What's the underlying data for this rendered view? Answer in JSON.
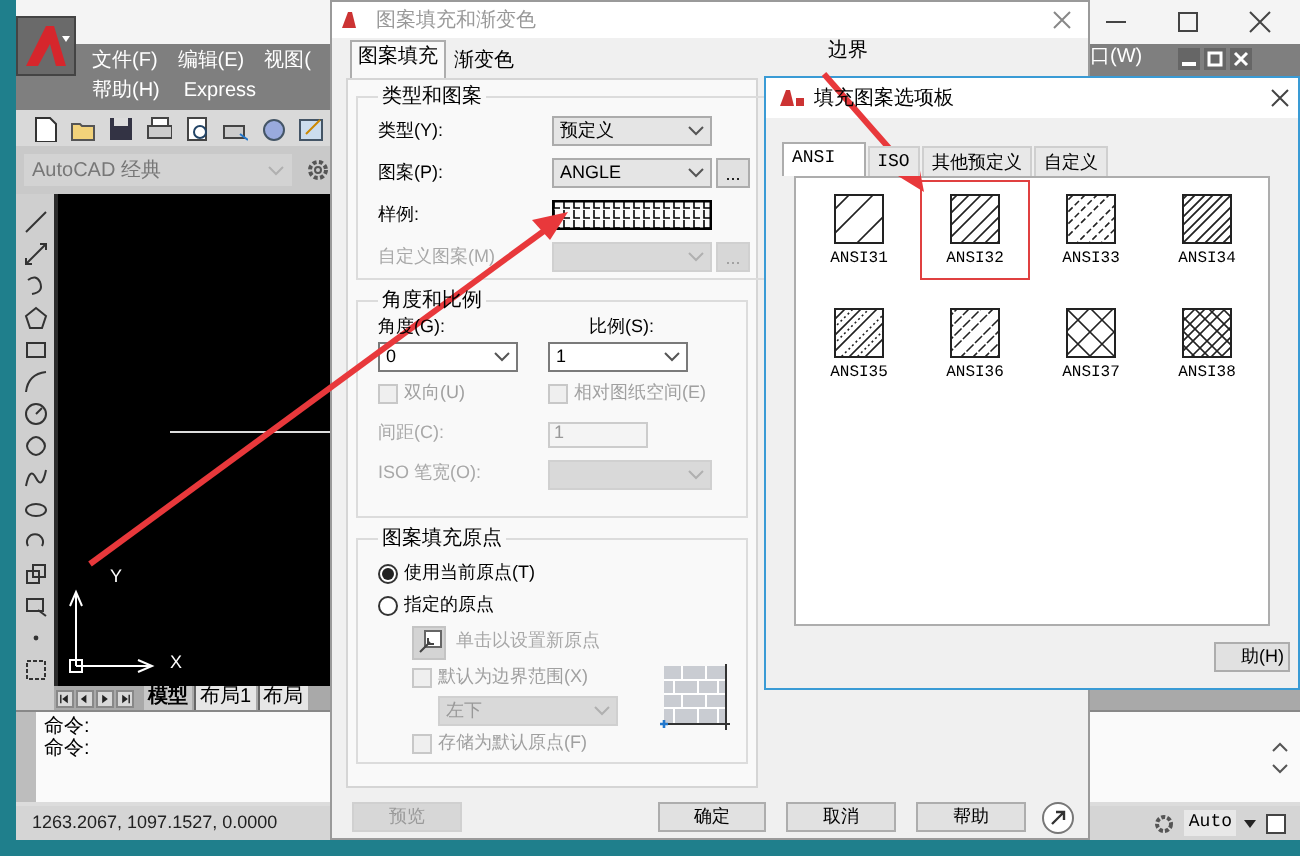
{
  "main_window": {
    "menu_row_1": [
      "文件(F)",
      "编辑(E)",
      "视图("
    ],
    "menu_row_2": [
      "帮助(H)",
      "Express"
    ],
    "menu_right": "口(W)",
    "workspace": "AutoCAD 经典",
    "axis_y": "Y",
    "axis_x": "X",
    "layout_tabs": [
      {
        "label": "模型",
        "selected": true
      },
      {
        "label": "布局1",
        "selected": false
      },
      {
        "label": "布局",
        "selected": false
      }
    ],
    "command_lines": [
      "命令:",
      "命令:"
    ],
    "coordinates": "1263.2067, 1097.1527, 0.0000",
    "status_mode": "Auto"
  },
  "hatch_dialog": {
    "title": "图案填充和渐变色",
    "tabs": [
      {
        "label": "图案填充",
        "selected": true
      },
      {
        "label": "渐变色",
        "selected": false
      }
    ],
    "boundary_heading": "边界",
    "type_group": {
      "heading": "类型和图案",
      "rows": [
        {
          "kind": "dropdown",
          "label": "类型(Y):",
          "value": "预定义",
          "disabled": false
        },
        {
          "kind": "dropdown_more",
          "label": "图案(P):",
          "value": "ANGLE",
          "more": "...",
          "disabled": false
        },
        {
          "kind": "swatch",
          "label": "样例:",
          "disabled": false
        },
        {
          "kind": "dropdown_more",
          "label": "自定义图案(M)",
          "more": "...",
          "disabled": true
        }
      ]
    },
    "angle_group": {
      "heading": "角度和比例",
      "angle": {
        "label": "角度(G):",
        "value": "0"
      },
      "scale": {
        "label": "比例(S):",
        "value": "1"
      },
      "checkboxes": [
        {
          "label": "双向(U)",
          "checked": false,
          "disabled": true
        },
        {
          "label": "相对图纸空间(E)",
          "checked": false,
          "disabled": true
        }
      ],
      "spacing": {
        "label": "间距(C):",
        "value": "1",
        "disabled": true
      },
      "iso_pen": {
        "label": "ISO 笔宽(O):",
        "disabled": true
      }
    },
    "origin_group": {
      "heading": "图案填充原点",
      "radios": [
        {
          "label": "使用当前原点(T)",
          "selected": true
        },
        {
          "label": "指定的原点",
          "selected": false
        }
      ],
      "set_button": {
        "label": "单击以设置新原点",
        "disabled": true
      },
      "checkboxes": [
        {
          "label": "默认为边界范围(X)",
          "checked": false,
          "disabled": true
        },
        {
          "label": "存储为默认原点(F)",
          "checked": false,
          "disabled": true
        }
      ],
      "position": {
        "value": "左下",
        "disabled": true
      }
    },
    "buttons": [
      {
        "label": "预览",
        "disabled": true
      },
      {
        "label": "确定",
        "disabled": false
      },
      {
        "label": "取消",
        "disabled": false
      },
      {
        "label": "帮助",
        "disabled": false
      }
    ]
  },
  "palette_dialog": {
    "title": "填充图案选项板",
    "tabs": [
      {
        "label": "ANSI",
        "selected": true
      },
      {
        "label": "ISO",
        "selected": false
      },
      {
        "label": "其他预定义",
        "selected": false
      },
      {
        "label": "自定义",
        "selected": false
      }
    ],
    "patterns": [
      {
        "name": "ANSI31",
        "selected": false
      },
      {
        "name": "ANSI32",
        "selected": true
      },
      {
        "name": "ANSI33",
        "selected": false
      },
      {
        "name": "ANSI34",
        "selected": false
      },
      {
        "name": "ANSI35",
        "selected": false
      },
      {
        "name": "ANSI36",
        "selected": false
      },
      {
        "name": "ANSI37",
        "selected": false
      },
      {
        "name": "ANSI38",
        "selected": false
      }
    ],
    "help_button": "助(H)"
  }
}
